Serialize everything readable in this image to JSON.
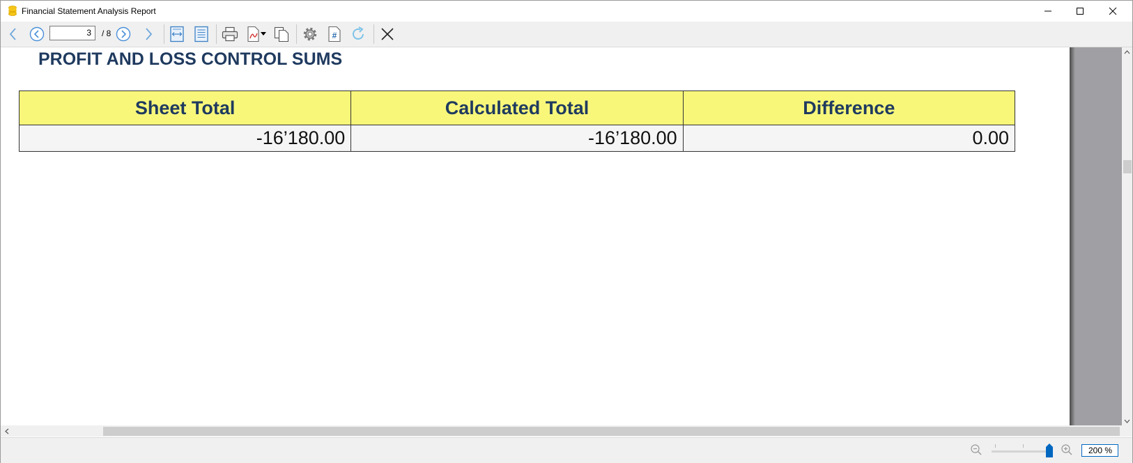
{
  "window": {
    "title": "Financial Statement Analysis Report"
  },
  "toolbar": {
    "page_current": "3",
    "page_total": "/ 8",
    "icons": [
      "back-icon",
      "previous-page-icon",
      "next-page-icon",
      "forward-icon",
      "fit-width-icon",
      "fit-page-icon",
      "print-icon",
      "export-pdf-icon",
      "copy-icon",
      "settings-icon",
      "page-number-icon",
      "refresh-icon",
      "close-icon"
    ]
  },
  "report": {
    "heading": "PROFIT AND LOSS CONTROL SUMS",
    "columns": [
      "Sheet Total",
      "Calculated Total",
      "Difference"
    ],
    "rows": [
      [
        "-16’180.00",
        "-16’180.00",
        "0.00"
      ]
    ]
  },
  "statusbar": {
    "zoom_value": "200 %",
    "zoom_level_fraction": 1.0
  },
  "colors": {
    "heading": "#1f3a5f",
    "header_fill": "#f8f77a",
    "accent": "#0067c0",
    "app_icon": "#f5c518"
  }
}
